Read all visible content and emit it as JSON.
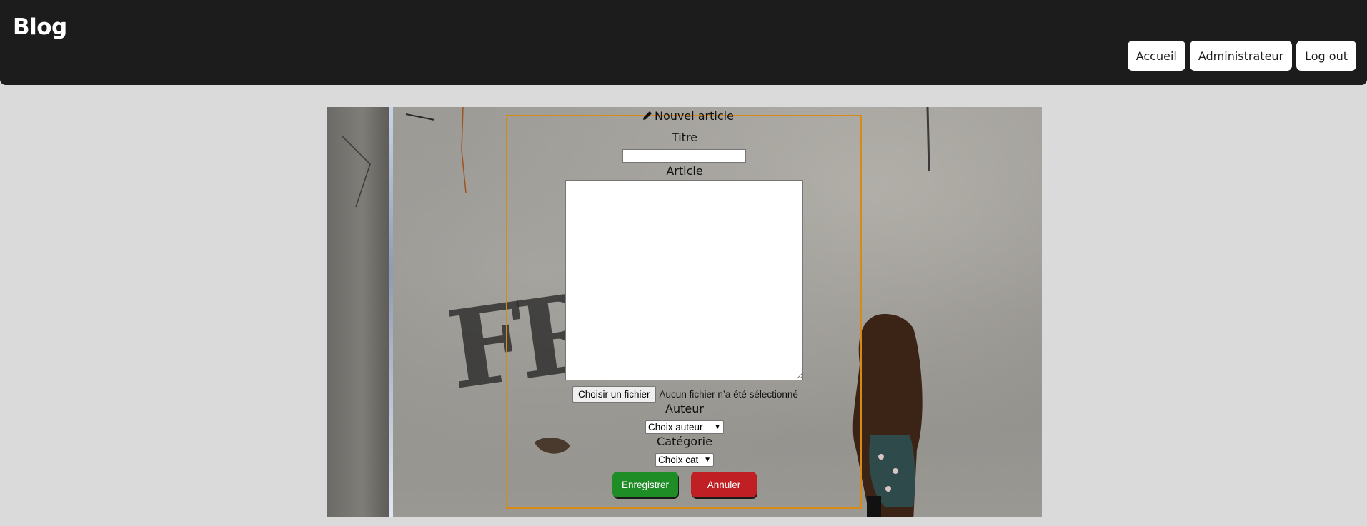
{
  "header": {
    "brand": "Blog",
    "nav": [
      "Accueil",
      "Administrateur",
      "Log out"
    ]
  },
  "form": {
    "legend": "Nouvel article",
    "legend_icon": "pencil-icon",
    "titre_label": "Titre",
    "titre_value": "",
    "article_label": "Article",
    "article_value": "",
    "file_button": "Choisir un fichier",
    "file_status": "Aucun fichier n’a été sélectionné",
    "auteur_label": "Auteur",
    "auteur_selected": "Choix auteur",
    "categorie_label": "Catégorie",
    "categorie_selected": "Choix cat",
    "save_button": "Enregistrer",
    "cancel_button": "Annuler"
  },
  "colors": {
    "header_bg": "#1c1c1c",
    "page_bg": "#dadada",
    "fieldset_border": "#d98a16",
    "save": "#1f8d26",
    "cancel": "#c01f24"
  }
}
